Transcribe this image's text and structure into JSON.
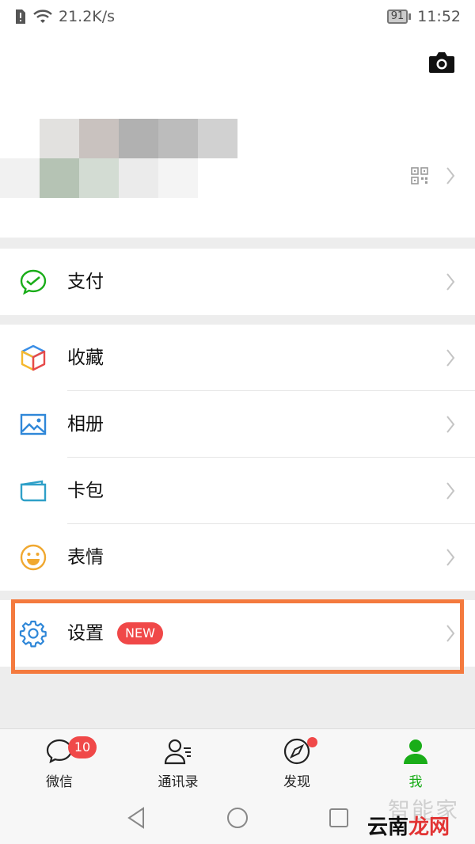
{
  "status_bar": {
    "network_speed": "21.2K/s",
    "battery": "91",
    "time": "11:52"
  },
  "profile": {
    "camera_icon": "camera-icon",
    "qr_icon": "qr-code-icon"
  },
  "menu": {
    "pay": {
      "label": "支付",
      "icon": "wechat-pay-icon"
    },
    "favorites": {
      "label": "收藏",
      "icon": "cube-icon"
    },
    "album": {
      "label": "相册",
      "icon": "picture-icon"
    },
    "cards": {
      "label": "卡包",
      "icon": "card-wallet-icon"
    },
    "stickers": {
      "label": "表情",
      "icon": "smiley-icon"
    },
    "settings": {
      "label": "设置",
      "badge": "NEW",
      "icon": "gear-icon"
    }
  },
  "tabbar": {
    "chats": {
      "label": "微信",
      "badge": "10"
    },
    "contacts": {
      "label": "通讯录"
    },
    "discover": {
      "label": "发现"
    },
    "me": {
      "label": "我"
    }
  },
  "watermark": {
    "line1": "智能家",
    "line2a": "云南",
    "line2b": "龙网"
  },
  "colors": {
    "accent_green": "#1aad19",
    "badge_red": "#f04848",
    "highlight_orange": "#f47a3e",
    "section_gap": "#ededed"
  }
}
